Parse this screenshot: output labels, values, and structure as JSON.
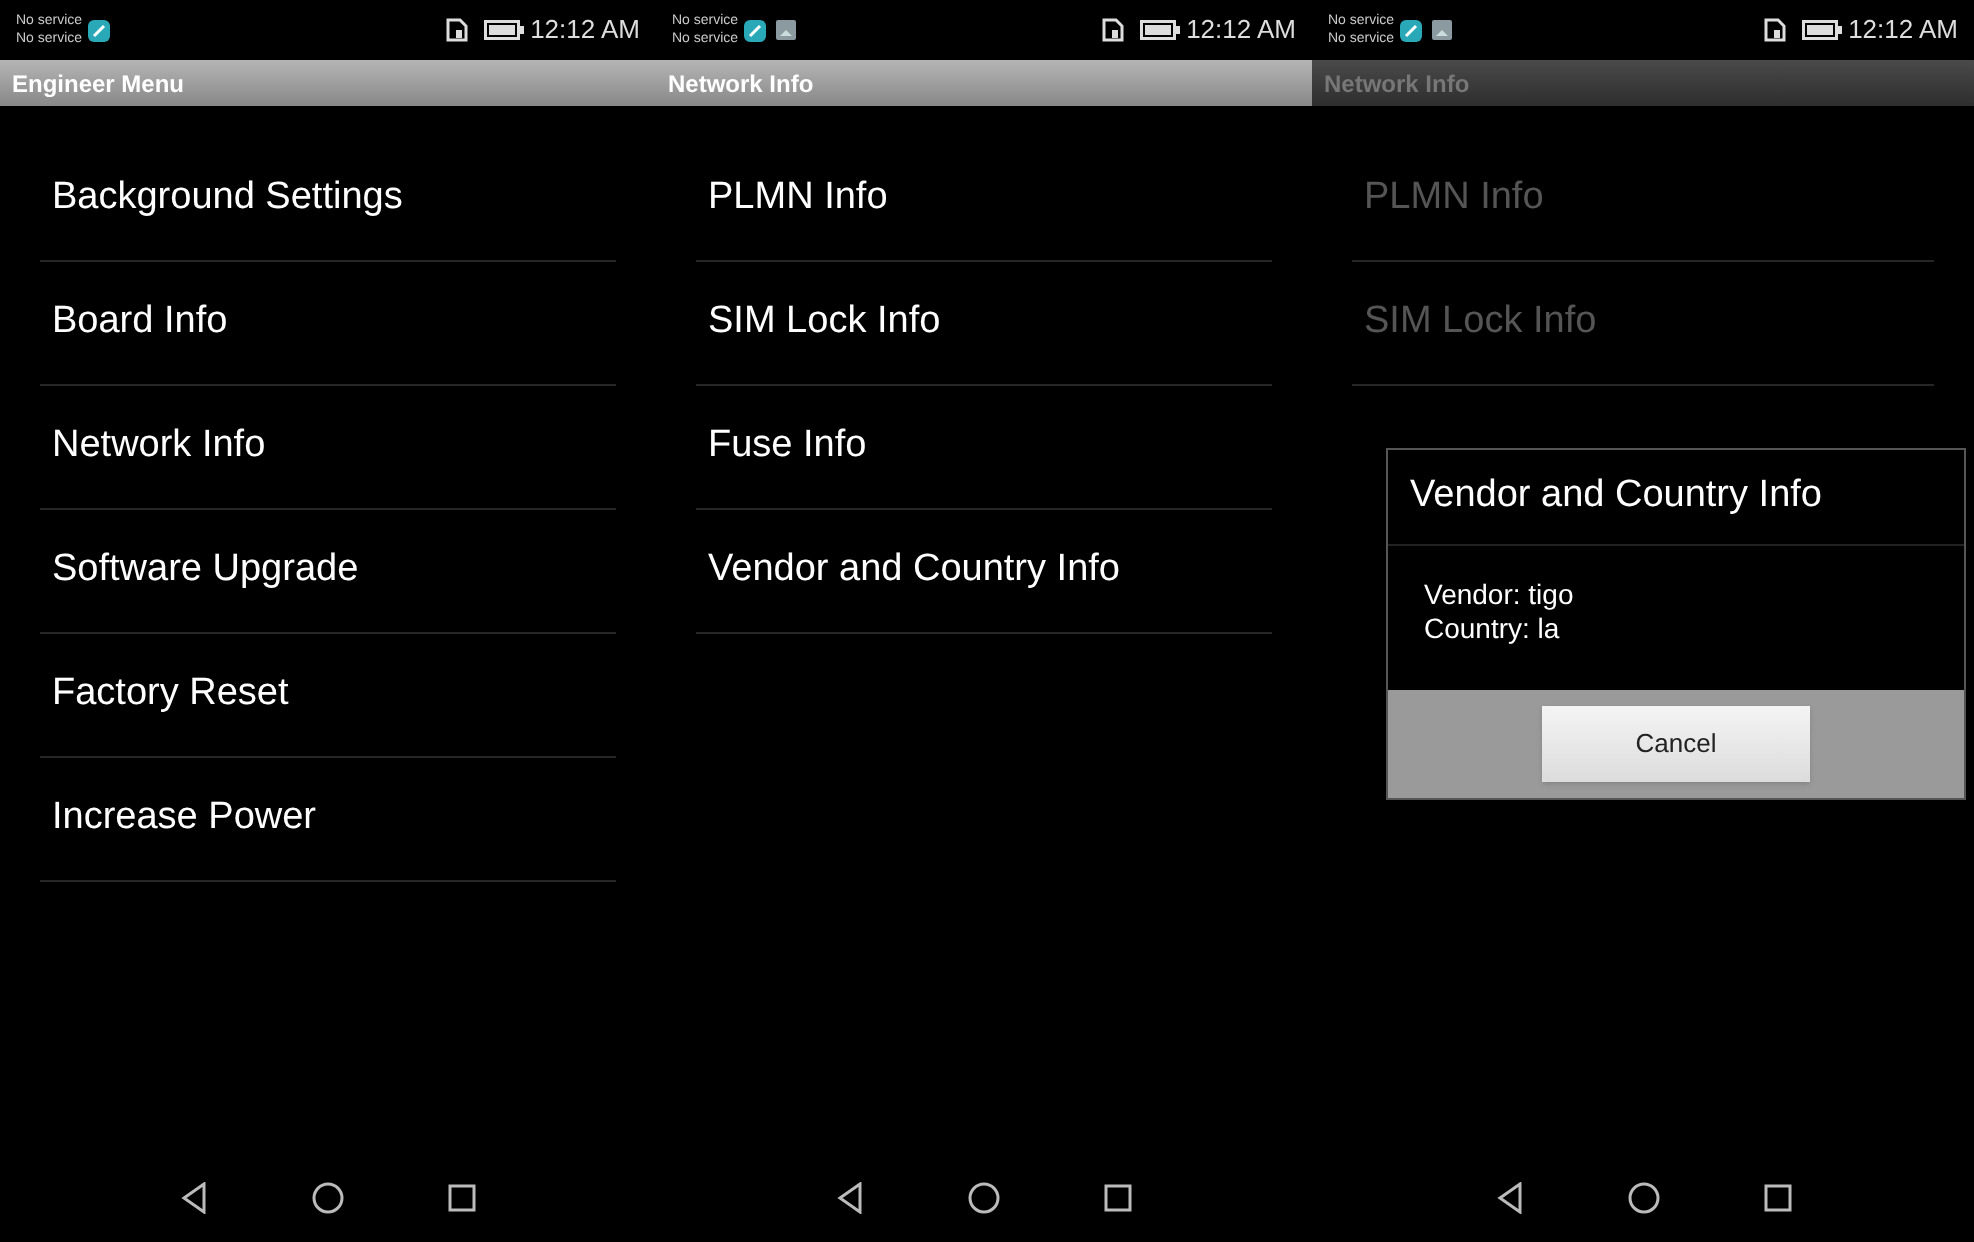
{
  "screens": [
    {
      "status": {
        "line1": "No service",
        "line2": "No service",
        "clock": "12:12 AM",
        "image_notification": false
      },
      "title": "Engineer Menu",
      "dimmed": false,
      "items": [
        "Background Settings",
        "Board Info",
        "Network Info",
        "Software Upgrade",
        "Factory Reset",
        "Increase Power"
      ]
    },
    {
      "status": {
        "line1": "No service",
        "line2": "No service",
        "clock": "12:12 AM",
        "image_notification": true
      },
      "title": "Network Info",
      "dimmed": false,
      "items": [
        "PLMN Info",
        "SIM Lock Info",
        "Fuse Info",
        "Vendor and Country Info"
      ]
    },
    {
      "status": {
        "line1": "No service",
        "line2": "No service",
        "clock": "12:12 AM",
        "image_notification": true
      },
      "title": "Network Info",
      "dimmed": true,
      "items": [
        "PLMN Info",
        "SIM Lock Info"
      ],
      "dialog": {
        "title": "Vendor and Country Info",
        "lines": [
          "Vendor: tigo",
          "Country: la"
        ],
        "button": "Cancel"
      }
    }
  ]
}
